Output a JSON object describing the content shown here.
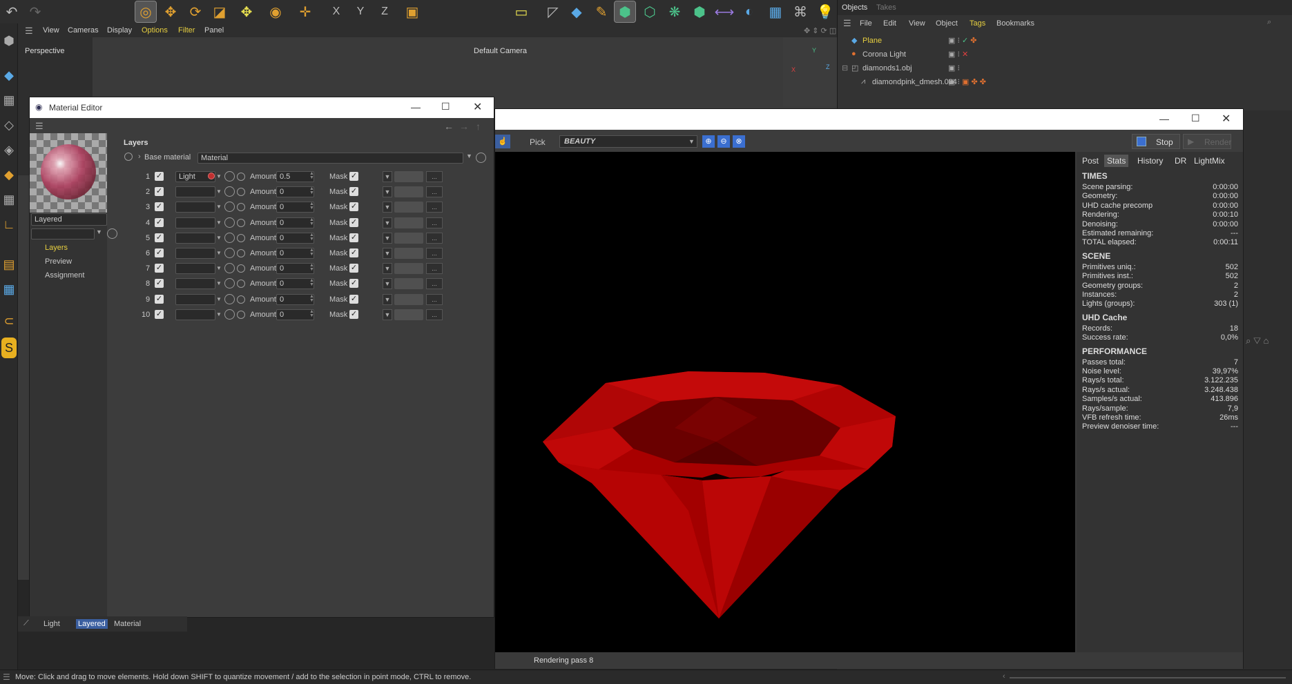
{
  "toolbar": {
    "undo_icon": "undo-icon",
    "redo_icon": "redo-icon"
  },
  "viewport": {
    "menu": [
      "View",
      "Cameras",
      "Display",
      "Options",
      "Filter",
      "Panel"
    ],
    "projection": "Perspective",
    "camera": "Default Camera"
  },
  "objects": {
    "tabs": [
      "Objects",
      "Takes"
    ],
    "menu": [
      "File",
      "Edit",
      "View",
      "Object",
      "Tags",
      "Bookmarks"
    ],
    "items": [
      {
        "name": "Plane"
      },
      {
        "name": "Corona Light"
      },
      {
        "name": "diamonds1.obj"
      },
      {
        "name": "diamondpink_dmesh.004"
      }
    ]
  },
  "material_editor": {
    "title": "Material Editor",
    "material_name": "Layered",
    "nav": [
      "Layers",
      "Preview",
      "Assignment"
    ],
    "section": "Layers",
    "base_label": "Base material",
    "base_value": "Material",
    "amount_label": "Amount",
    "mask_label": "Mask",
    "more_label": "...",
    "layers": [
      {
        "num": "1",
        "material": "Light",
        "amount": "0.5"
      },
      {
        "num": "2",
        "material": "",
        "amount": "0"
      },
      {
        "num": "3",
        "material": "",
        "amount": "0"
      },
      {
        "num": "4",
        "material": "",
        "amount": "0"
      },
      {
        "num": "5",
        "material": "",
        "amount": "0"
      },
      {
        "num": "6",
        "material": "",
        "amount": "0"
      },
      {
        "num": "7",
        "material": "",
        "amount": "0"
      },
      {
        "num": "8",
        "material": "",
        "amount": "0"
      },
      {
        "num": "9",
        "material": "",
        "amount": "0"
      },
      {
        "num": "10",
        "material": "",
        "amount": "0"
      }
    ]
  },
  "material_tabs": [
    "Light",
    "Layered",
    "Material"
  ],
  "vfb": {
    "pick": "Pick",
    "channel": "BEAUTY",
    "stop": "Stop",
    "render": "Render",
    "tabs": [
      "Post",
      "Stats",
      "History",
      "DR",
      "LightMix"
    ],
    "status": "Rendering pass 8",
    "sections": [
      {
        "title": "TIMES",
        "rows": [
          [
            "Scene parsing:",
            "0:00:00"
          ],
          [
            "Geometry:",
            "0:00:00"
          ],
          [
            "UHD cache precomp",
            "0:00:00"
          ],
          [
            "Rendering:",
            "0:00:10"
          ],
          [
            "Denoising:",
            "0:00:00"
          ],
          [
            "Estimated remaining:",
            "---"
          ],
          [
            "TOTAL elapsed:",
            "0:00:11"
          ]
        ]
      },
      {
        "title": "SCENE",
        "rows": [
          [
            "Primitives uniq.:",
            "502"
          ],
          [
            "Primitives inst.:",
            "502"
          ],
          [
            "Geometry groups:",
            "2"
          ],
          [
            "Instances:",
            "2"
          ],
          [
            "Lights (groups):",
            "303 (1)"
          ]
        ]
      },
      {
        "title": "UHD Cache",
        "rows": [
          [
            "Records:",
            "18"
          ],
          [
            "Success rate:",
            "0,0%"
          ]
        ]
      },
      {
        "title": "PERFORMANCE",
        "rows": [
          [
            "Passes total:",
            "7"
          ],
          [
            "Noise level:",
            "39,97%"
          ],
          [
            "Rays/s total:",
            "3.122.235"
          ],
          [
            "Rays/s actual:",
            "3.248.438"
          ],
          [
            "Samples/s actual:",
            "413.896"
          ],
          [
            "Rays/sample:",
            "7,9"
          ],
          [
            "VFB refresh time:",
            "26ms"
          ],
          [
            "Preview denoiser time:",
            "---"
          ]
        ]
      }
    ]
  },
  "statusbar": {
    "text": "Move: Click and drag to move elements. Hold down SHIFT to quantize movement / add to the selection in point mode, CTRL to remove."
  },
  "colors": {
    "accent": "#e0a030",
    "diamond": "#b00000",
    "selected_tab": "#3b5fa0"
  }
}
